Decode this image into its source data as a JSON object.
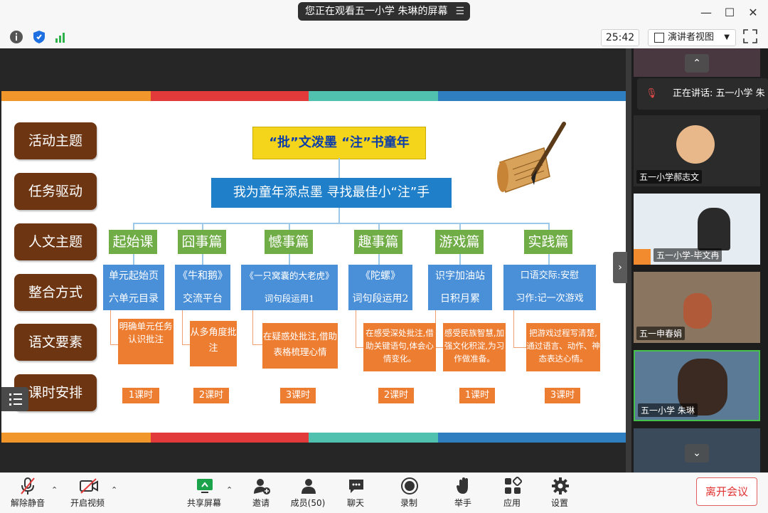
{
  "window": {
    "share_banner": "您正在观看五一小学 朱琳的屏幕",
    "timer": "25:42",
    "view_mode": "演讲者视图"
  },
  "slide": {
    "side_labels": [
      "活动主题",
      "任务驱动",
      "人文主题",
      "整合方式",
      "语文要素",
      "课时安排"
    ],
    "title": "“批”文泼墨 “注”书童年",
    "subtitle": "我为童年添点墨 寻找最佳小“注”手",
    "columns": [
      {
        "head": "起始课",
        "box": [
          "单元起始页",
          "六单元目录"
        ],
        "task": "明确单元任务\n认识批注",
        "hours": "1课时"
      },
      {
        "head": "囧事篇",
        "box": [
          "《牛和鹅》",
          "交流平台"
        ],
        "task": "从多角度批注",
        "hours": "2课时"
      },
      {
        "head": "憾事篇",
        "box": [
          "《一只窝囊的大老虎》",
          "词句段运用1"
        ],
        "task": "在疑惑处批注,借助表格梳理心情",
        "hours": "3课时"
      },
      {
        "head": "趣事篇",
        "box": [
          "《陀螺》",
          "词句段运用2"
        ],
        "task": "在感受深处批注,借助关键语句,体会心情变化。",
        "hours": "2课时"
      },
      {
        "head": "游戏篇",
        "box": [
          "识字加油站",
          "日积月累"
        ],
        "task": "感受民族智慧,加强文化积淀,为习作做准备。",
        "hours": "1课时"
      },
      {
        "head": "实践篇",
        "box": [
          "口语交际:安慰",
          "习作:记一次游戏"
        ],
        "task": "把游戏过程写清楚,通过语言、动作、神态表达心情。",
        "hours": "3课时"
      }
    ]
  },
  "participants": {
    "speaking": "正在讲话: 五一小学 朱",
    "tiles": [
      {
        "name": "五一小学郝志文"
      },
      {
        "name": "五一小学-毕文冉"
      },
      {
        "name": "五一申春娟"
      },
      {
        "name": "五一小学 朱琳"
      }
    ]
  },
  "bottom": {
    "mute": "解除静音",
    "video": "开启视频",
    "share": "共享屏幕",
    "invite": "邀请",
    "members": "成员(50)",
    "chat": "聊天",
    "record": "录制",
    "raise": "举手",
    "apps": "应用",
    "settings": "设置",
    "leave": "离开会议"
  }
}
